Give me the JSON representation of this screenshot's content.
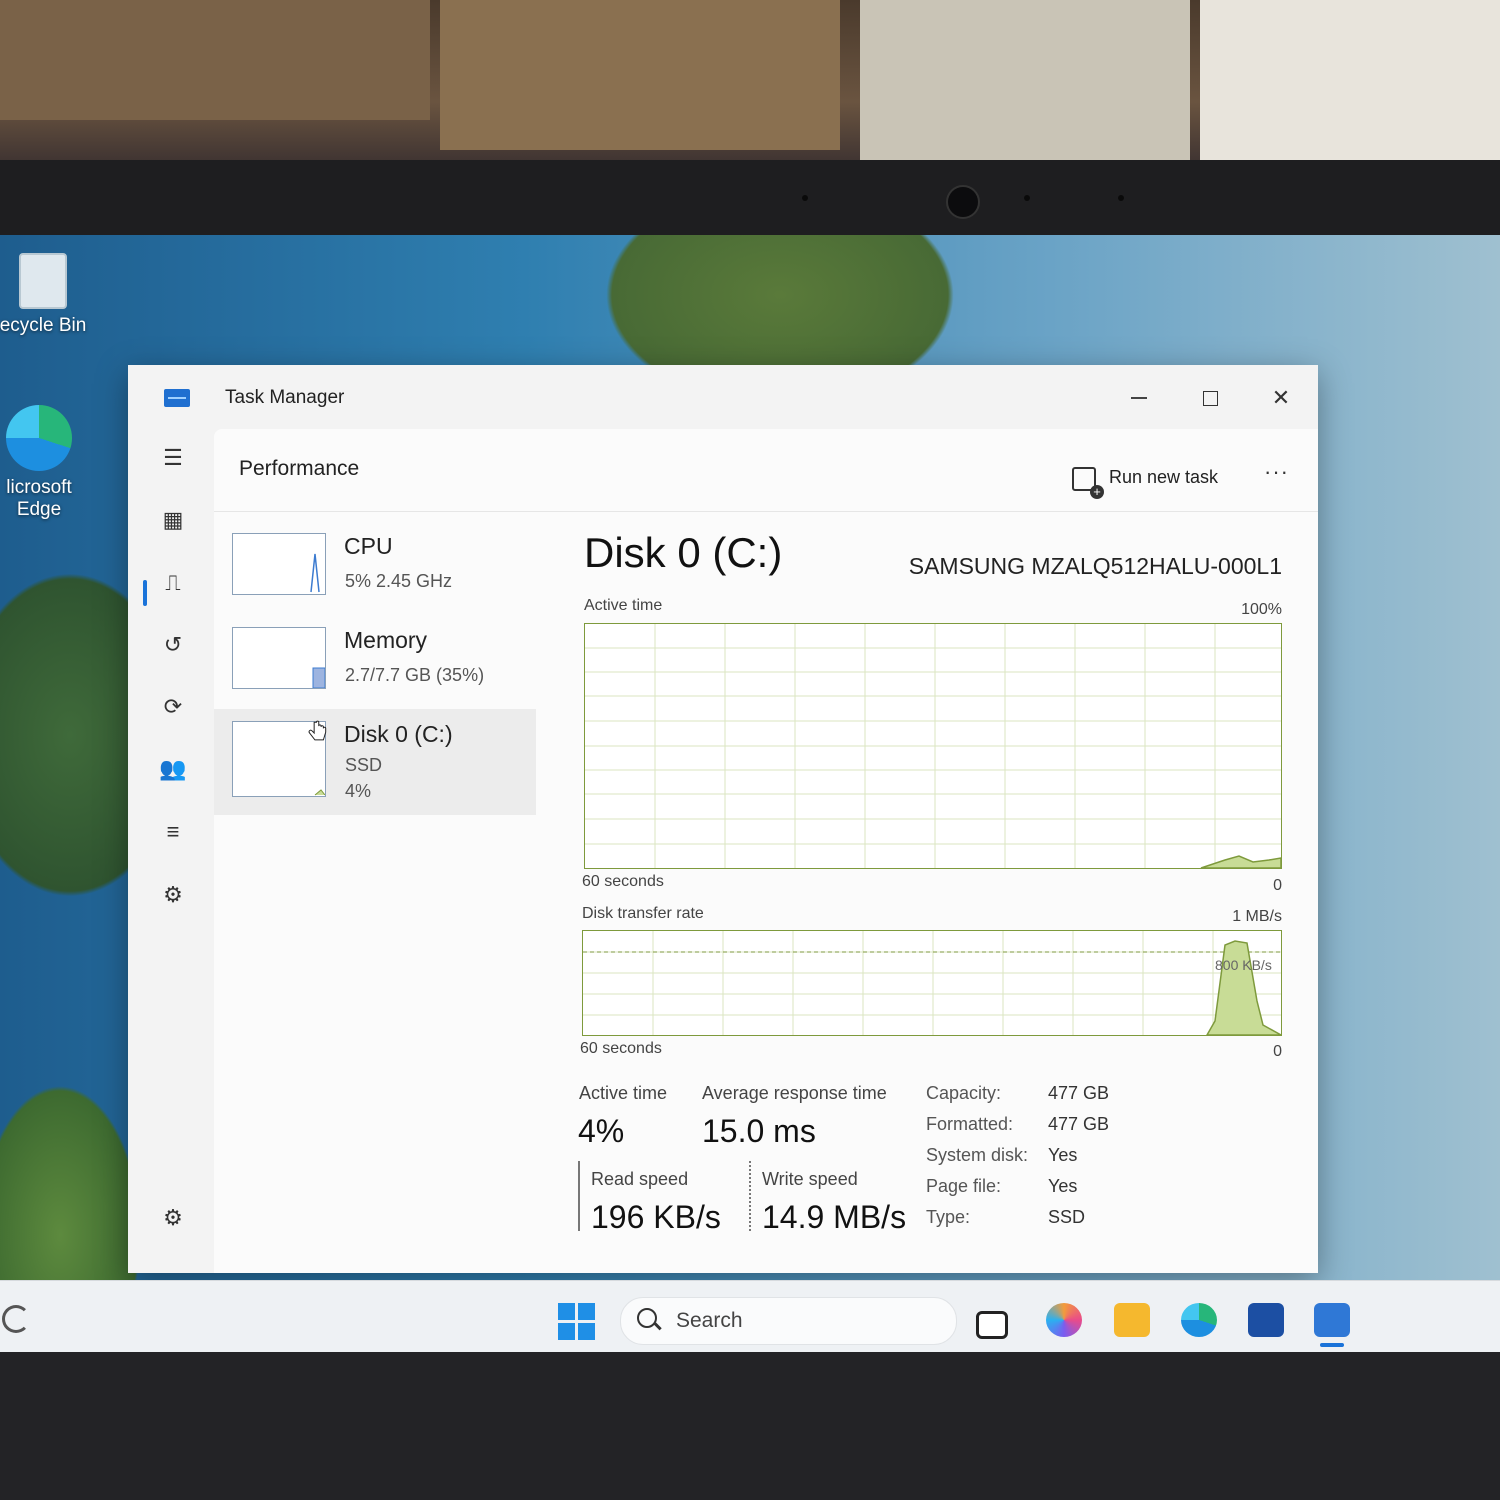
{
  "desktop": {
    "icons": [
      {
        "label": "ecycle Bin"
      },
      {
        "label_line1": "licrosoft",
        "label_line2": "Edge"
      }
    ]
  },
  "taskbar": {
    "search_label": "Search",
    "apps": [
      "task-view-icon",
      "copilot-icon",
      "file-explorer-icon",
      "edge-icon",
      "store-icon",
      "task-manager-icon"
    ]
  },
  "window": {
    "title": "Task Manager",
    "page_title": "Performance",
    "run_new_task": "Run new task",
    "more": "···"
  },
  "nav": [
    "menu-icon",
    "processes-icon",
    "performance-icon",
    "app-history-icon",
    "startup-apps-icon",
    "users-icon",
    "details-icon",
    "services-icon",
    "settings-icon"
  ],
  "devices": [
    {
      "name": "CPU",
      "line1": "5%  2.45 GHz",
      "line2": ""
    },
    {
      "name": "Memory",
      "line1": "2.7/7.7 GB (35%)",
      "line2": ""
    },
    {
      "name": "Disk 0 (C:)",
      "line1": "SSD",
      "line2": "4%"
    }
  ],
  "disk": {
    "title": "Disk 0 (C:)",
    "model": "SAMSUNG MZALQ512HALU-000L1",
    "active_time_label": "Active time",
    "active_time_max": "100%",
    "active_time_span": "60 seconds",
    "active_time_min": "0",
    "transfer_label": "Disk transfer rate",
    "transfer_max": "1 MB/s",
    "transfer_mark": "800 KB/s",
    "transfer_span": "60 seconds",
    "transfer_min": "0",
    "stats": {
      "active_time_label": "Active time",
      "active_time_value": "4%",
      "avg_response_label": "Average response time",
      "avg_response_value": "15.0 ms",
      "read_label": "Read speed",
      "read_value": "196 KB/s",
      "write_label": "Write speed",
      "write_value": "14.9 MB/s"
    },
    "properties": [
      {
        "key": "Capacity:",
        "value": "477 GB"
      },
      {
        "key": "Formatted:",
        "value": "477 GB"
      },
      {
        "key": "System disk:",
        "value": "Yes"
      },
      {
        "key": "Page file:",
        "value": "Yes"
      },
      {
        "key": "Type:",
        "value": "SSD"
      }
    ]
  },
  "colors": {
    "accent": "#1a73d9",
    "graph_line": "#7e9a3c",
    "graph_fill": "#c8dc96"
  }
}
